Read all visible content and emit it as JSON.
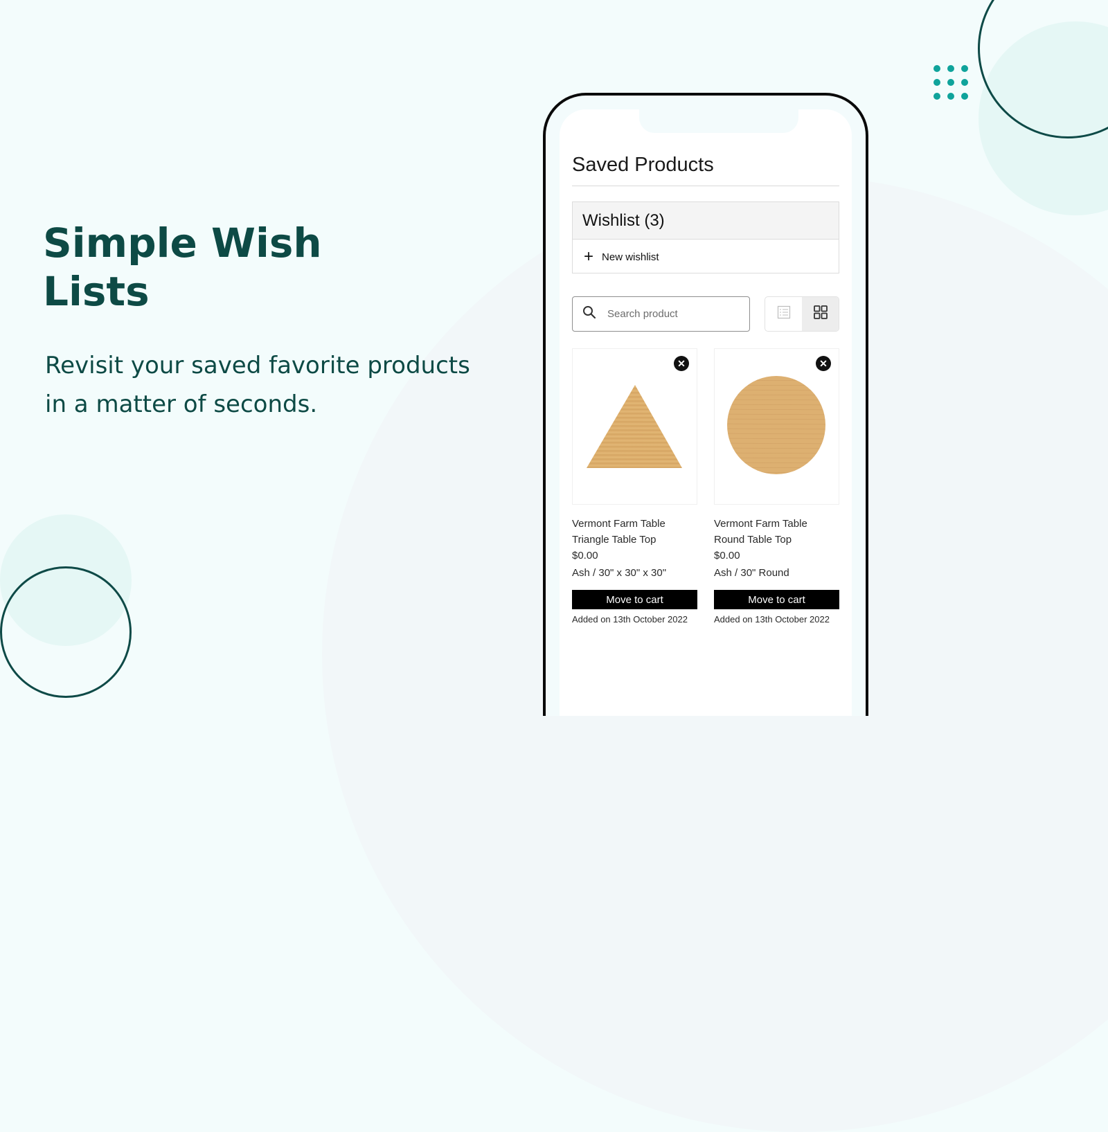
{
  "hero": {
    "title": "Simple Wish Lists",
    "subtitle": "Revisit your saved favorite products in a matter of seconds."
  },
  "colors": {
    "brand_dark": "#0d4a45",
    "accent_teal": "#0fa39b",
    "background": "#f3fcfc"
  },
  "app": {
    "title": "Saved Products",
    "wishlist": {
      "label": "Wishlist (3)",
      "new_label": "New wishlist"
    },
    "search": {
      "placeholder": "Search product",
      "value": ""
    },
    "view_toggle": {
      "options": [
        "list-view",
        "grid-view"
      ],
      "active": "grid-view"
    },
    "products": [
      {
        "name_line1": "Vermont Farm Table",
        "name_line2": "Triangle Table Top",
        "price": "$0.00",
        "variant": "Ash / 30\" x 30\" x 30\"",
        "shape": "triangle",
        "action": "Move to cart",
        "added": "Added on 13th October 2022"
      },
      {
        "name_line1": "Vermont Farm Table",
        "name_line2": "Round Table Top",
        "price": "$0.00",
        "variant": "Ash / 30\" Round",
        "shape": "circle",
        "action": "Move to cart",
        "added": "Added on 13th October 2022"
      }
    ]
  }
}
